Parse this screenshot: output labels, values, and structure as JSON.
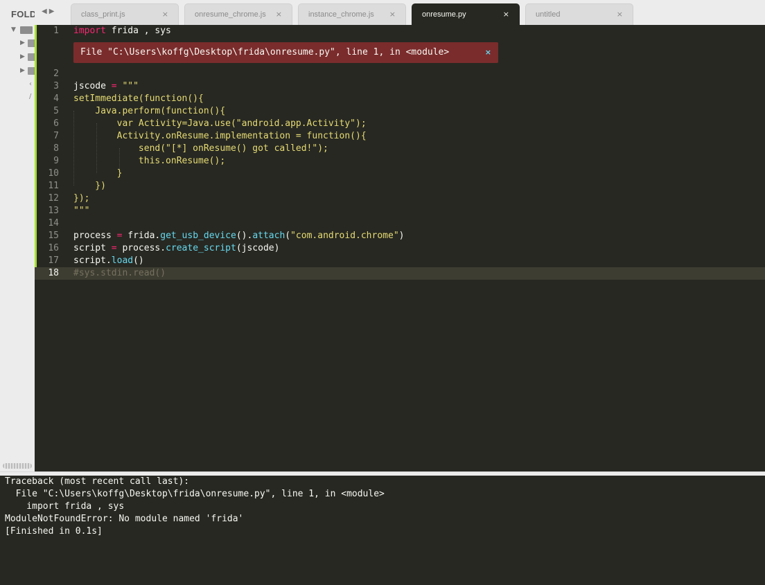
{
  "sidebar": {
    "label": "FOLDERS"
  },
  "tabs": [
    {
      "label": "class_print.js",
      "close": "×",
      "active": false
    },
    {
      "label": "onresume_chrome.js",
      "close": "×",
      "active": false
    },
    {
      "label": "instance_chrome.js",
      "close": "×",
      "active": false
    },
    {
      "label": "onresume.py",
      "close": "×",
      "active": true
    },
    {
      "label": "untitled",
      "close": "×",
      "active": false
    }
  ],
  "nav": {
    "back": "◀",
    "forward": "▶"
  },
  "error_phantom": {
    "text": "File \"C:\\Users\\koffg\\Desktop\\frida\\onresume.py\", line 1, in <module>",
    "close": "×"
  },
  "code": {
    "lines": [
      {
        "n": "1",
        "parts": [
          {
            "t": "import",
            "c": "kw"
          },
          {
            "t": " frida , sys"
          }
        ]
      },
      {
        "n": "2",
        "parts": []
      },
      {
        "n": "3",
        "parts": [
          {
            "t": "jscode "
          },
          {
            "t": "=",
            "c": "op"
          },
          {
            "t": " "
          },
          {
            "t": "\"\"\"",
            "c": "str"
          }
        ]
      },
      {
        "n": "4",
        "parts": [
          {
            "t": "setImmediate(function(){",
            "c": "str"
          }
        ]
      },
      {
        "n": "5",
        "parts": [
          {
            "t": "    Java.perform(function(){",
            "c": "str"
          }
        ]
      },
      {
        "n": "6",
        "parts": [
          {
            "t": "        var Activity=Java.use(\"android.app.Activity\");",
            "c": "str"
          }
        ]
      },
      {
        "n": "7",
        "parts": [
          {
            "t": "        Activity.onResume.implementation = function(){",
            "c": "str"
          }
        ]
      },
      {
        "n": "8",
        "parts": [
          {
            "t": "            send(\"[*] onResume() got called!\");",
            "c": "str"
          }
        ]
      },
      {
        "n": "9",
        "parts": [
          {
            "t": "            this.onResume();",
            "c": "str"
          }
        ]
      },
      {
        "n": "10",
        "parts": [
          {
            "t": "        }",
            "c": "str"
          }
        ]
      },
      {
        "n": "11",
        "parts": [
          {
            "t": "    })",
            "c": "str"
          }
        ]
      },
      {
        "n": "12",
        "parts": [
          {
            "t": "});",
            "c": "str"
          }
        ]
      },
      {
        "n": "13",
        "parts": [
          {
            "t": "\"\"\"",
            "c": "str"
          }
        ]
      },
      {
        "n": "14",
        "parts": []
      },
      {
        "n": "15",
        "parts": [
          {
            "t": "process "
          },
          {
            "t": "=",
            "c": "op"
          },
          {
            "t": " frida."
          },
          {
            "t": "get_usb_device",
            "c": "fn"
          },
          {
            "t": "()."
          },
          {
            "t": "attach",
            "c": "fn"
          },
          {
            "t": "("
          },
          {
            "t": "\"com.android.chrome\"",
            "c": "str"
          },
          {
            "t": ")"
          }
        ]
      },
      {
        "n": "16",
        "parts": [
          {
            "t": "script "
          },
          {
            "t": "=",
            "c": "op"
          },
          {
            "t": " process."
          },
          {
            "t": "create_script",
            "c": "fn"
          },
          {
            "t": "(jscode)"
          }
        ]
      },
      {
        "n": "17",
        "parts": [
          {
            "t": "script."
          },
          {
            "t": "load",
            "c": "fn"
          },
          {
            "t": "()"
          }
        ]
      },
      {
        "n": "18",
        "parts": [
          {
            "t": "#sys.stdin.read()",
            "c": "cm"
          }
        ]
      }
    ]
  },
  "output": {
    "lines": [
      "Traceback (most recent call last):",
      "  File \"C:\\Users\\koffg\\Desktop\\frida\\onresume.py\", line 1, in <module>",
      "    import frida , sys",
      "ModuleNotFoundError: No module named 'frida'",
      "[Finished in 0.1s]"
    ]
  }
}
